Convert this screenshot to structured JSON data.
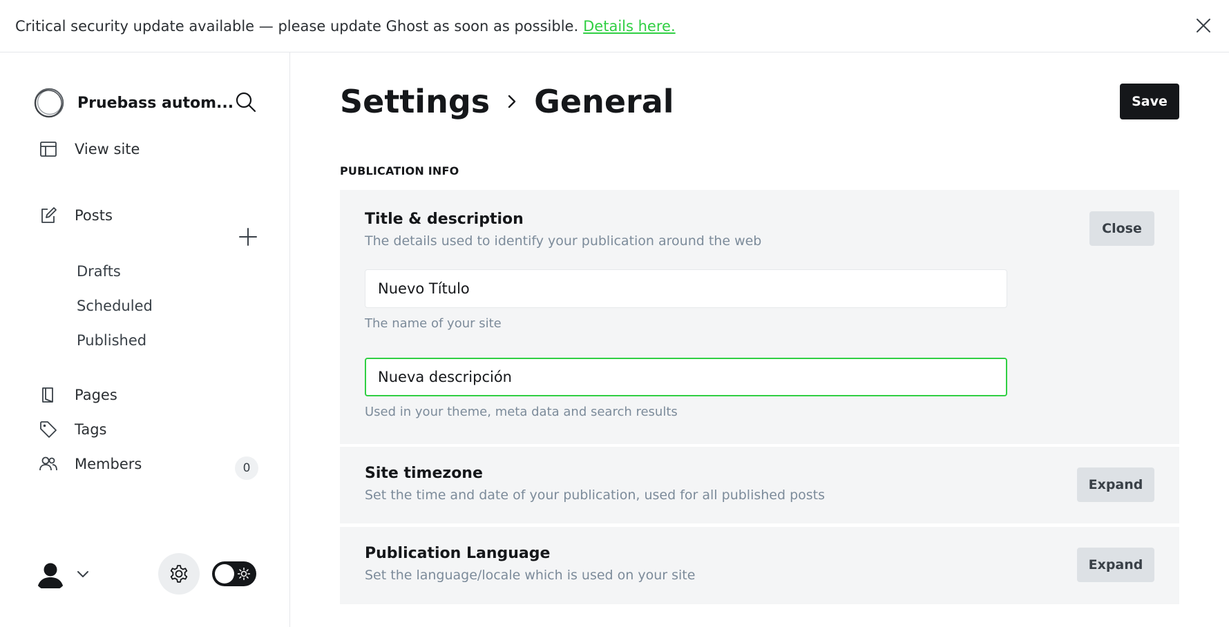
{
  "banner": {
    "message": "Critical security update available — please update Ghost as soon as possible.",
    "link_label": "Details here.",
    "close_icon": "close-icon"
  },
  "sidebar": {
    "site_name": "Pruebass autom...",
    "view_site": "View site",
    "posts": "Posts",
    "drafts": "Drafts",
    "scheduled": "Scheduled",
    "published": "Published",
    "pages": "Pages",
    "tags": "Tags",
    "members": "Members",
    "members_count": "0"
  },
  "header": {
    "crumb_parent": "Settings",
    "crumb_current": "General",
    "save_label": "Save"
  },
  "section": {
    "title": "PUBLICATION INFO"
  },
  "title_description": {
    "title": "Title & description",
    "description": "The details used to identify your publication around the web",
    "button": "Close",
    "site_title_value": "Nuevo Título",
    "site_title_hint": "The name of your site",
    "site_description_value": "Nueva descripción",
    "site_description_hint": "Used in your theme, meta data and search results"
  },
  "timezone": {
    "title": "Site timezone",
    "description": "Set the time and date of your publication, used for all published posts",
    "button": "Expand"
  },
  "language": {
    "title": "Publication Language",
    "description": "Set the language/locale which is used on your site",
    "button": "Expand"
  },
  "colors": {
    "accent": "#30cf43",
    "dark": "#15171a",
    "panel": "#f4f5f6",
    "muted": "#7c8b9a"
  }
}
